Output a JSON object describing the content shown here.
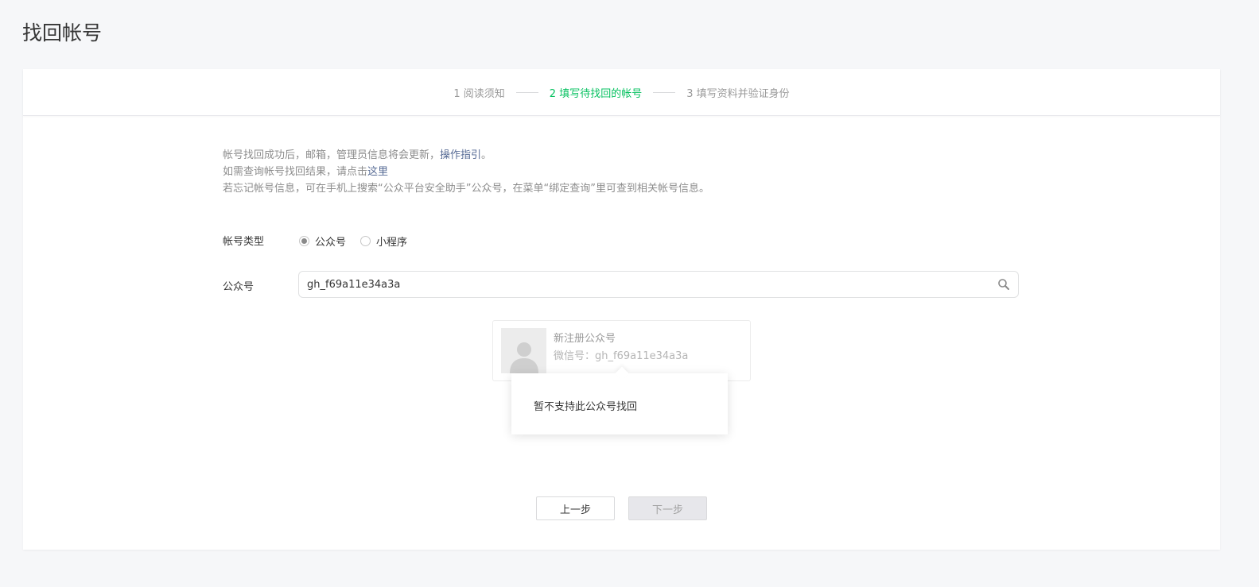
{
  "page": {
    "title": "找回帐号"
  },
  "steps": [
    {
      "label": "1 阅读须知",
      "state": "done"
    },
    {
      "label": "2 填写待找回的帐号",
      "state": "active"
    },
    {
      "label": "3 填写资料并验证身份",
      "state": "todo"
    }
  ],
  "notice": {
    "line1_text": "帐号找回成功后，邮箱，管理员信息将会更新，",
    "line1_link": "操作指引",
    "line1_end": "。",
    "line2_text": "如需查询帐号找回结果，请点击",
    "line2_link": "这里",
    "line3_text": "若忘记帐号信息，可在手机上搜索“公众平台安全助手”公众号，在菜单“绑定查询”里可查到相关帐号信息。"
  },
  "account_type": {
    "label": "帐号类型",
    "options": [
      {
        "label": "公众号",
        "checked": true
      },
      {
        "label": "小程序",
        "checked": false
      }
    ]
  },
  "account_field": {
    "label": "公众号",
    "value": "gh_f69a11e34a3a",
    "icon": "search-icon"
  },
  "result": {
    "name": "新注册公众号",
    "wechat_id": "微信号：gh_f69a11e34a3a",
    "avatar_icon": "default-avatar-icon"
  },
  "tooltip": {
    "text": "暂不支持此公众号找回"
  },
  "buttons": {
    "prev": "上一步",
    "next": "下一步"
  },
  "colors": {
    "active_step": "#07c160",
    "link": "#576b95",
    "background": "#f6f7f9",
    "disabled_button": "#e7e7eb"
  }
}
